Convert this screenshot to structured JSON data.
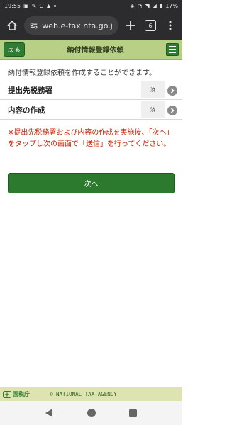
{
  "status_bar": {
    "time": "19:55",
    "battery": "17%"
  },
  "browser": {
    "url": "web.e-tax.nta.go.jp",
    "tab_count": "6"
  },
  "header": {
    "back_label": "戻る",
    "title": "納付情報登録依頼"
  },
  "intro_text": "納付情報登録依頼を作成することができます。",
  "rows": [
    {
      "label": "提出先税務署",
      "status": "済"
    },
    {
      "label": "内容の作成",
      "status": "済"
    }
  ],
  "notice_text": "※提出先税務署および内容の作成を実施後、「次へ」をタップし次の画面で「送信」を行ってください。",
  "next_button": "次へ",
  "footer": {
    "agency": "国税庁",
    "copyright": "© NATIONAL TAX AGENCY"
  },
  "colors": {
    "header_bg": "#b8cf86",
    "button_green": "#2c7a2e",
    "notice_red": "#cc2200",
    "footer_bg": "#dde4b2"
  }
}
